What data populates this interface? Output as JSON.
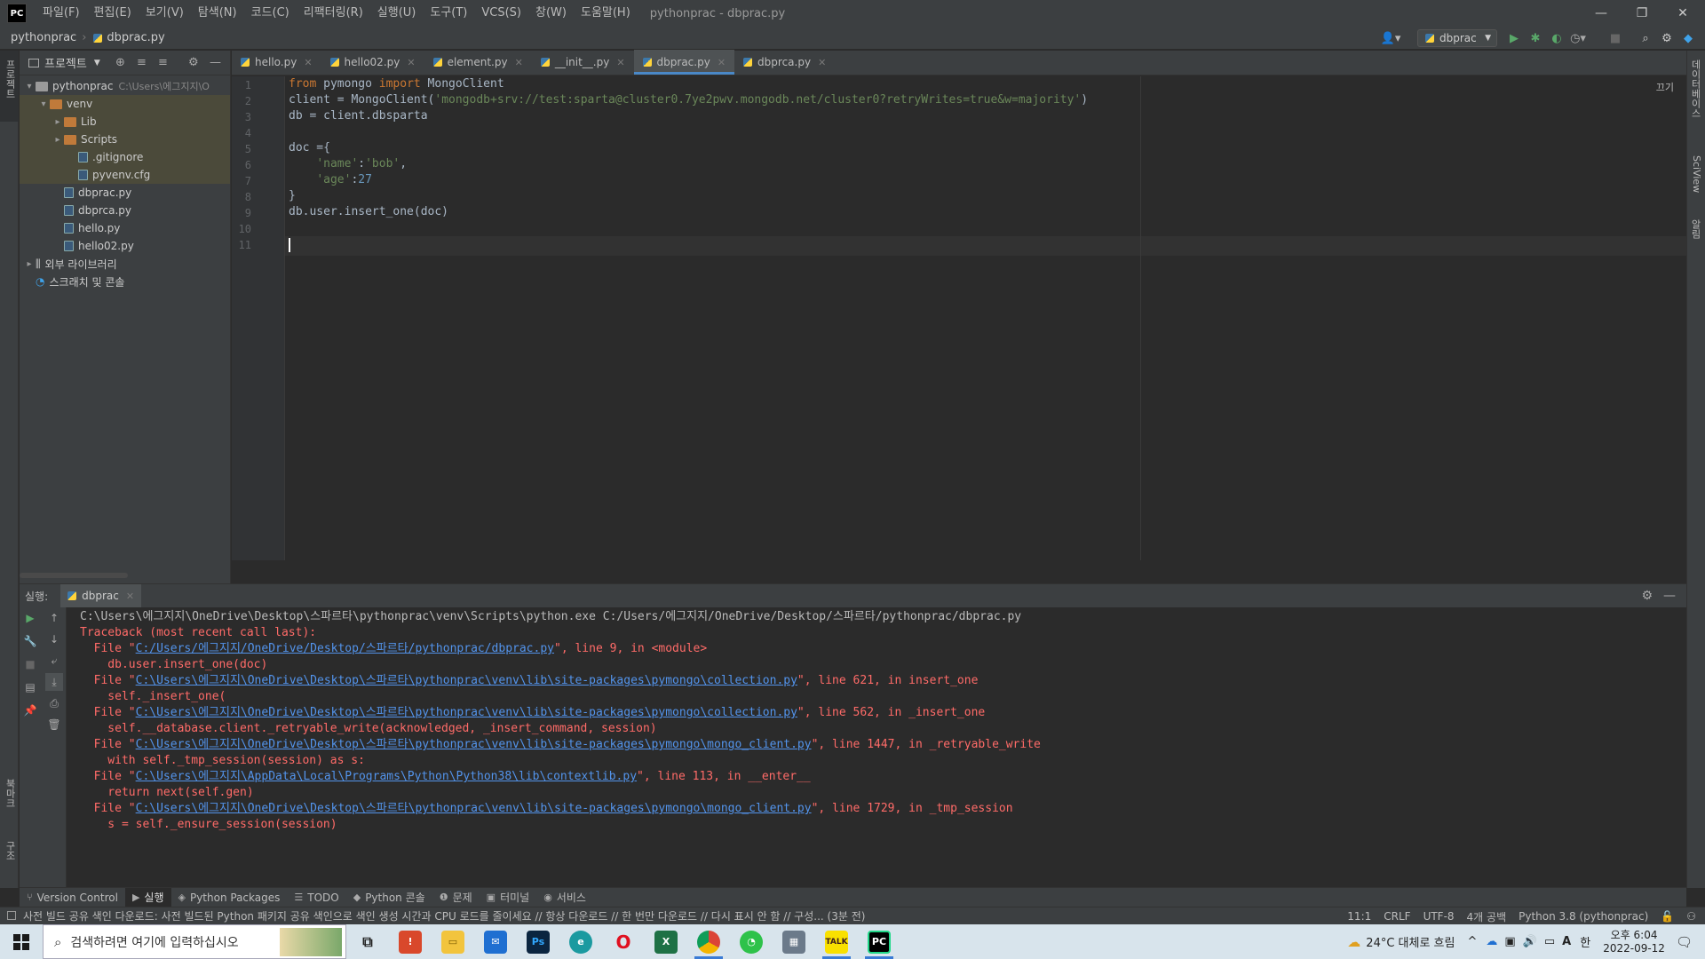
{
  "menubar": {
    "logo": "PC",
    "items": [
      "파일(F)",
      "편집(E)",
      "보기(V)",
      "탐색(N)",
      "코드(C)",
      "리팩터링(R)",
      "실행(U)",
      "도구(T)",
      "VCS(S)",
      "창(W)",
      "도움말(H)"
    ],
    "title": "pythonprac - dbprac.py",
    "minimize": "—",
    "restore": "❐",
    "close": "✕"
  },
  "navbar": {
    "project": "pythonprac",
    "file": "dbprac.py",
    "run_config": "dbprac"
  },
  "leftstrip": {
    "project_label": "프로젝트",
    "bookmarks_label": "북마크",
    "structure_label": "구조"
  },
  "rightstrip": {
    "database_label": "데이터베이스",
    "sciview_label": "SciView",
    "notifications_label": "알림"
  },
  "project_panel": {
    "header": "프로젝트",
    "tree": [
      {
        "label": "pythonprac",
        "sub": "C:\\Users\\에그지지\\O",
        "type": "folder-grey",
        "indent": 0,
        "arrow": "▾"
      },
      {
        "label": "venv",
        "type": "folder",
        "indent": 1,
        "arrow": "▾"
      },
      {
        "label": "Lib",
        "type": "folder",
        "indent": 2,
        "arrow": "▸"
      },
      {
        "label": "Scripts",
        "type": "folder",
        "indent": 2,
        "arrow": "▸"
      },
      {
        "label": ".gitignore",
        "type": "file",
        "indent": 3,
        "arrow": ""
      },
      {
        "label": "pyvenv.cfg",
        "type": "file",
        "indent": 3,
        "arrow": ""
      },
      {
        "label": "dbprac.py",
        "type": "file",
        "indent": 2,
        "arrow": ""
      },
      {
        "label": "dbprca.py",
        "type": "file",
        "indent": 2,
        "arrow": ""
      },
      {
        "label": "hello.py",
        "type": "file",
        "indent": 2,
        "arrow": ""
      },
      {
        "label": "hello02.py",
        "type": "file",
        "indent": 2,
        "arrow": ""
      },
      {
        "label": "외부 라이브러리",
        "type": "lib",
        "indent": 0,
        "arrow": "▸"
      },
      {
        "label": "스크래치 및 콘솔",
        "type": "scratch",
        "indent": 0,
        "arrow": ""
      }
    ]
  },
  "tabs": [
    {
      "label": "hello.py",
      "active": false
    },
    {
      "label": "hello02.py",
      "active": false
    },
    {
      "label": "element.py",
      "active": false
    },
    {
      "label": "__init__.py",
      "active": false
    },
    {
      "label": "dbprac.py",
      "active": true
    },
    {
      "label": "dbprca.py",
      "active": false
    }
  ],
  "editor": {
    "reader_mode": "끄기",
    "line_numbers": [
      "1",
      "2",
      "3",
      "4",
      "5",
      "6",
      "7",
      "8",
      "9",
      "10",
      "11"
    ],
    "lines": [
      [
        {
          "t": "from",
          "c": "kw"
        },
        {
          "t": " pymongo ",
          "c": ""
        },
        {
          "t": "import",
          "c": "kw"
        },
        {
          "t": " MongoClient",
          "c": ""
        }
      ],
      [
        {
          "t": "client = MongoClient(",
          "c": ""
        },
        {
          "t": "'mongodb+srv://test:sparta@cluster0.7ye2pwv.mongodb.net/cluster0?retryWrites=true&w=majority'",
          "c": "str"
        },
        {
          "t": ")",
          "c": ""
        }
      ],
      [
        {
          "t": "db = client.dbsparta",
          "c": ""
        }
      ],
      [],
      [
        {
          "t": "doc ={",
          "c": ""
        }
      ],
      [
        {
          "t": "    ",
          "c": ""
        },
        {
          "t": "'name'",
          "c": "str"
        },
        {
          "t": ":",
          "c": ""
        },
        {
          "t": "'bob'",
          "c": "str"
        },
        {
          "t": ",",
          "c": ""
        }
      ],
      [
        {
          "t": "    ",
          "c": ""
        },
        {
          "t": "'age'",
          "c": "str"
        },
        {
          "t": ":",
          "c": ""
        },
        {
          "t": "27",
          "c": "num"
        }
      ],
      [
        {
          "t": "}",
          "c": ""
        }
      ],
      [
        {
          "t": "db.user.insert_one(doc)",
          "c": ""
        }
      ],
      [],
      []
    ]
  },
  "run_panel": {
    "label": "실행:",
    "tab": "dbprac",
    "console": [
      {
        "c": "norm",
        "parts": [
          {
            "t": "C:\\Users\\에그지지\\OneDrive\\Desktop\\스파르타\\pythonprac\\venv\\Scripts\\python.exe C:/Users/에그지지/OneDrive/Desktop/스파르타/pythonprac/dbprac.py"
          }
        ]
      },
      {
        "c": "err",
        "parts": [
          {
            "t": "Traceback (most recent call last):"
          }
        ]
      },
      {
        "c": "err",
        "parts": [
          {
            "t": "  File \""
          },
          {
            "t": "C:/Users/에그지지/OneDrive/Desktop/스파르타/pythonprac/dbprac.py",
            "l": true
          },
          {
            "t": "\", line 9, in <module>"
          }
        ]
      },
      {
        "c": "err",
        "parts": [
          {
            "t": "    db.user.insert_one(doc)"
          }
        ]
      },
      {
        "c": "err",
        "parts": [
          {
            "t": "  File \""
          },
          {
            "t": "C:\\Users\\에그지지\\OneDrive\\Desktop\\스파르타\\pythonprac\\venv\\lib\\site-packages\\pymongo\\collection.py",
            "l": true
          },
          {
            "t": "\", line 621, in insert_one"
          }
        ]
      },
      {
        "c": "err",
        "parts": [
          {
            "t": "    self._insert_one("
          }
        ]
      },
      {
        "c": "err",
        "parts": [
          {
            "t": "  File \""
          },
          {
            "t": "C:\\Users\\에그지지\\OneDrive\\Desktop\\스파르타\\pythonprac\\venv\\lib\\site-packages\\pymongo\\collection.py",
            "l": true
          },
          {
            "t": "\", line 562, in _insert_one"
          }
        ]
      },
      {
        "c": "err",
        "parts": [
          {
            "t": "    self.__database.client._retryable_write(acknowledged, _insert_command, session)"
          }
        ]
      },
      {
        "c": "err",
        "parts": [
          {
            "t": "  File \""
          },
          {
            "t": "C:\\Users\\에그지지\\OneDrive\\Desktop\\스파르타\\pythonprac\\venv\\lib\\site-packages\\pymongo\\mongo_client.py",
            "l": true
          },
          {
            "t": "\", line 1447, in _retryable_write"
          }
        ]
      },
      {
        "c": "err",
        "parts": [
          {
            "t": "    with self._tmp_session(session) as s:"
          }
        ]
      },
      {
        "c": "err",
        "parts": [
          {
            "t": "  File \""
          },
          {
            "t": "C:\\Users\\에그지지\\AppData\\Local\\Programs\\Python\\Python38\\lib\\contextlib.py",
            "l": true
          },
          {
            "t": "\", line 113, in __enter__"
          }
        ]
      },
      {
        "c": "err",
        "parts": [
          {
            "t": "    return next(self.gen)"
          }
        ]
      },
      {
        "c": "err",
        "parts": [
          {
            "t": "  File \""
          },
          {
            "t": "C:\\Users\\에그지지\\OneDrive\\Desktop\\스파르타\\pythonprac\\venv\\lib\\site-packages\\pymongo\\mongo_client.py",
            "l": true
          },
          {
            "t": "\", line 1729, in _tmp_session"
          }
        ]
      },
      {
        "c": "err",
        "parts": [
          {
            "t": "    s = self._ensure_session(session)"
          }
        ]
      }
    ]
  },
  "bottom_tabs": [
    {
      "icon": "⑂",
      "label": "Version Control",
      "active": false
    },
    {
      "icon": "▶",
      "label": "실행",
      "active": true
    },
    {
      "icon": "◈",
      "label": "Python Packages",
      "active": false
    },
    {
      "icon": "☰",
      "label": "TODO",
      "active": false
    },
    {
      "icon": "◆",
      "label": "Python 콘솔",
      "active": false
    },
    {
      "icon": "❶",
      "label": "문제",
      "active": false
    },
    {
      "icon": "▣",
      "label": "터미널",
      "active": false
    },
    {
      "icon": "◉",
      "label": "서비스",
      "active": false
    }
  ],
  "statusbar": {
    "message": "사전 빌드 공유 색인 다운로드: 사전 빌드된 Python 패키지 공유 색인으로 색인 생성 시간과 CPU 로드를 줄이세요 // 항상 다운로드 // 한 번만 다운로드 // 다시 표시 안 함 // 구성... (3분 전)",
    "position": "11:1",
    "line_sep": "CRLF",
    "encoding": "UTF-8",
    "indent": "4개 공백",
    "interpreter": "Python 3.8 (pythonprac)"
  },
  "taskbar": {
    "search_placeholder": "검색하려면 여기에 입력하십시오",
    "weather": "24°C 대체로 흐림",
    "time": "오후 6:04",
    "date": "2022-09-12",
    "ime": "한",
    "ime2": "A"
  }
}
